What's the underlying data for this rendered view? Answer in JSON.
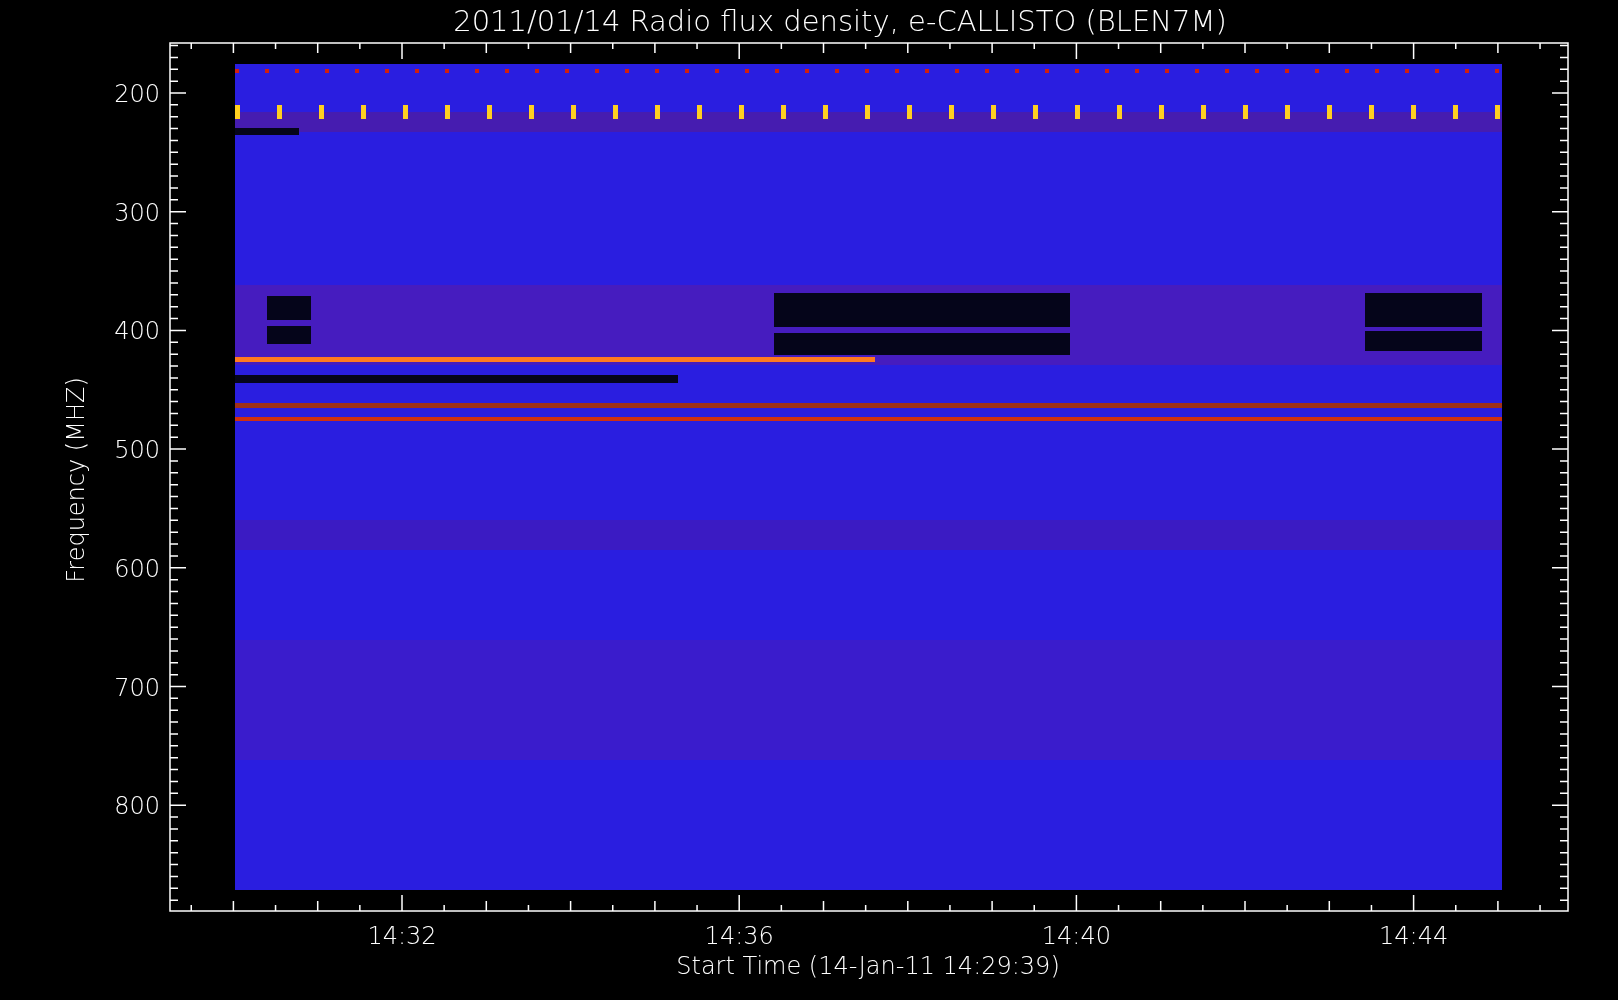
{
  "title": "2011/01/14  Radio flux density, e-CALLISTO (BLEN7M)",
  "y_axis": {
    "label": "Frequency (MHZ)",
    "ticks": [
      "200",
      "300",
      "400",
      "500",
      "600",
      "700",
      "800"
    ]
  },
  "x_axis": {
    "label": "Start Time (14-Jan-11 14:29:39)",
    "ticks": [
      "14:32",
      "14:36",
      "14:40",
      "14:44"
    ]
  }
}
